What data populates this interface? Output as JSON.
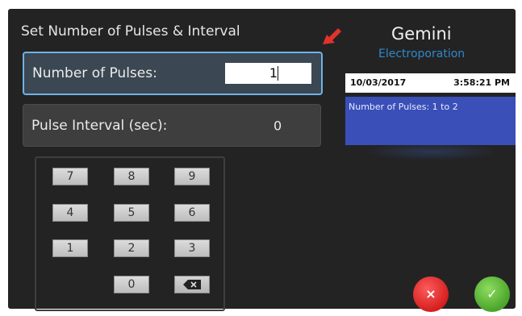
{
  "screen": {
    "title": "Set Number of Pulses & Interval",
    "back_icon": "back-arrow-icon"
  },
  "fields": {
    "pulses": {
      "label": "Number of Pulses:",
      "value": "1"
    },
    "interval": {
      "label": "Pulse Interval (sec):",
      "value": "0"
    }
  },
  "keypad": {
    "keys": [
      "7",
      "8",
      "9",
      "4",
      "5",
      "6",
      "1",
      "2",
      "3",
      "0"
    ],
    "backspace_icon": "backspace-icon"
  },
  "brand": {
    "name": "Gemini",
    "subtitle": "Electroporation"
  },
  "status": {
    "date": "10/03/2017",
    "time": "3:58:21 PM"
  },
  "info": {
    "message": "Number of Pulses: 1 to 2"
  },
  "buttons": {
    "cancel_symbol": "×",
    "ok_symbol": "✓"
  },
  "colors": {
    "panel_bg": "#232323",
    "accent_blue": "#2f89c9",
    "info_blue": "#3a4fb7",
    "cancel_red": "#d41f1f",
    "ok_green": "#4aa52b",
    "arrow_red": "#e0332b"
  }
}
